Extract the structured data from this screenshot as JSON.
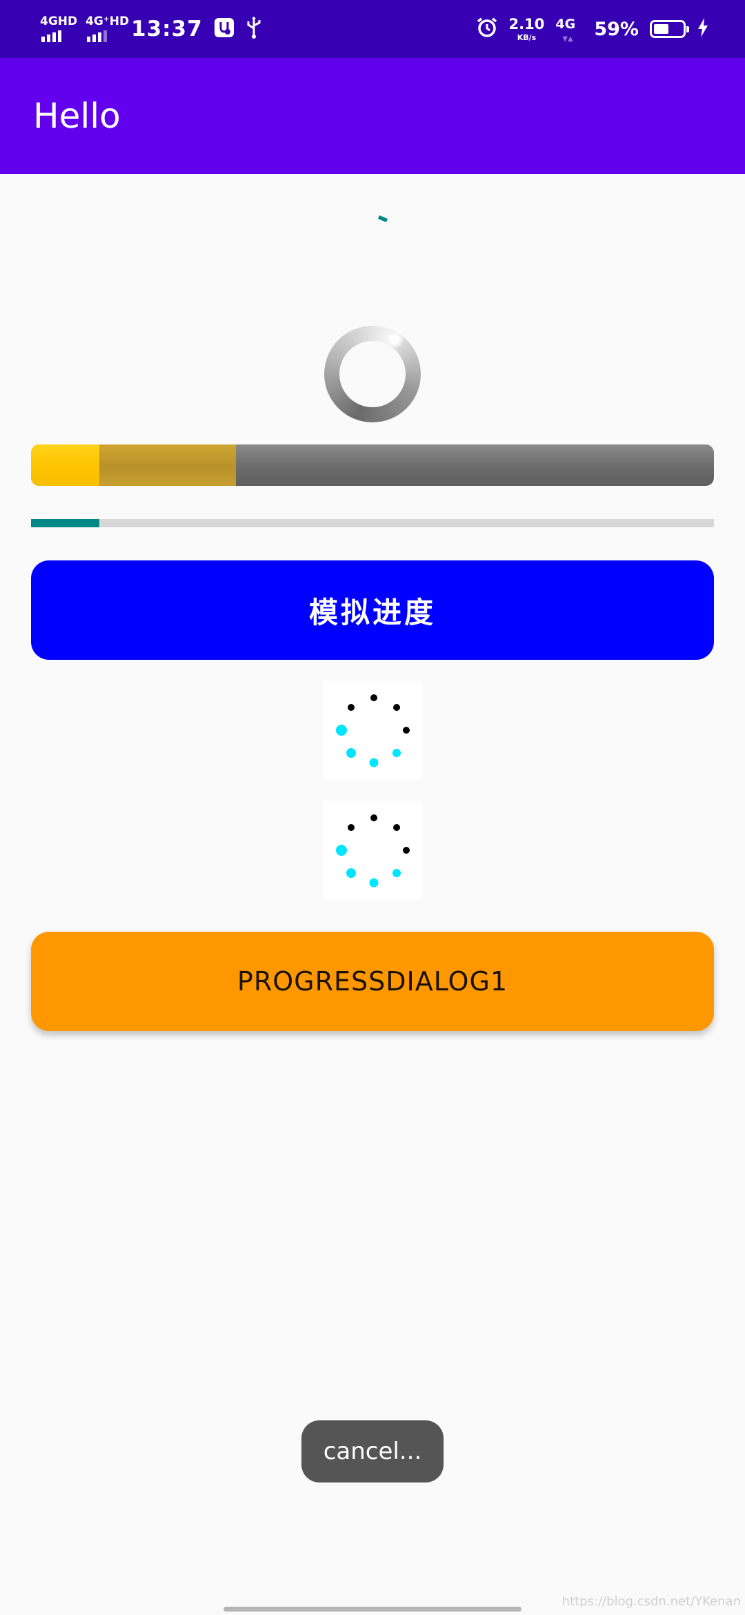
{
  "status_bar": {
    "net1_label": "4GHD",
    "net2_label": "4G⁺HD",
    "time": "13:37",
    "speed_value": "2.10",
    "speed_unit": "KB/s",
    "net3_label": "4G",
    "battery_percent": "59%",
    "battery_level": 0.59,
    "icons": [
      "signal-icon",
      "signal-icon",
      "usb-debug-icon",
      "usb-icon",
      "alarm-icon",
      "battery-icon",
      "charging-icon"
    ]
  },
  "app_bar": {
    "title": "Hello",
    "color": "#6200ee"
  },
  "progress_bar": {
    "progress": 0.1,
    "secondary_progress": 0.3,
    "progress_color": "#ffc400",
    "secondary_color": "#c79f30"
  },
  "thin_progress": {
    "progress": 0.1,
    "color": "#018786"
  },
  "simulate_button": {
    "label": "模拟进度",
    "color": "#0000ff"
  },
  "dialog_button": {
    "label": "PROGRESSDIALOG1",
    "color": "#ff9800"
  },
  "toast": {
    "text": "cancel..."
  },
  "watermark": {
    "text": "https://blog.csdn.net/YKenan"
  }
}
